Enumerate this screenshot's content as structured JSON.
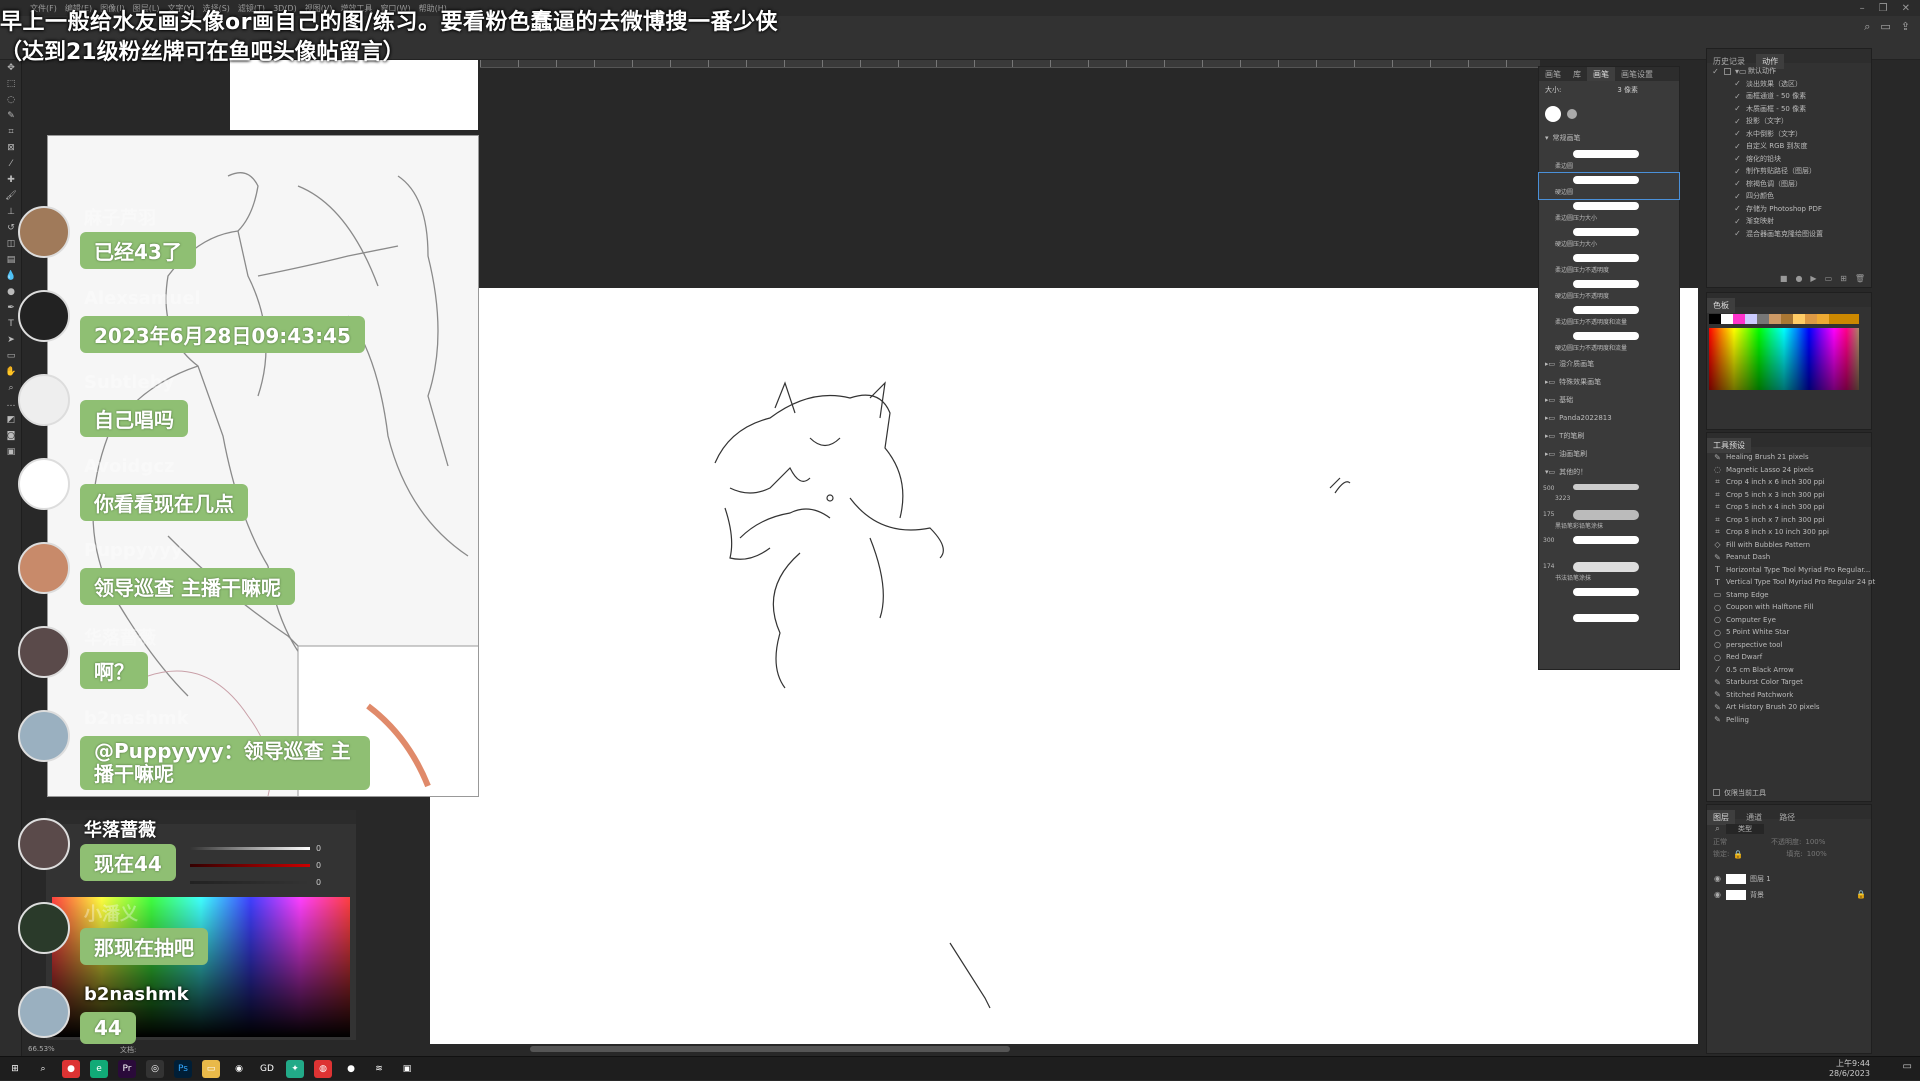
{
  "banner": {
    "line1": "早上一般给水友画头像or画自己的图/练习。要看粉色蠢逼的去微博搜一番少侠",
    "line2": "（达到21级粉丝牌可在鱼吧头像帖留言）"
  },
  "chat": [
    {
      "user": "麻子芦羽",
      "text": "已经43了"
    },
    {
      "user": "Alexsamuel",
      "text": "2023年6月28日09:43:45"
    },
    {
      "user": "Subtleby",
      "text": "自己唱吗"
    },
    {
      "user": "Avoidgcz",
      "text": "你看看现在几点"
    },
    {
      "user": "Puppyyyy",
      "text": "领导巡查 主播干嘛呢"
    },
    {
      "user": "华落蔷薇",
      "text": "啊？"
    },
    {
      "user": "b2nashmk",
      "text": "@Puppyyyy：领导巡查 主播干嘛呢"
    },
    {
      "user": "华落蔷薇",
      "text": "现在44"
    },
    {
      "user": "小潘义",
      "text": "那现在抽吧"
    },
    {
      "user": "b2nashmk",
      "text": "44"
    }
  ],
  "brush_panel": {
    "tabs": [
      "画笔",
      "库",
      "画笔",
      "画笔设置"
    ],
    "size_label": "大小:",
    "size_value": "3 像素",
    "group": "常规画笔",
    "brushes": [
      "柔边圆",
      "硬边圆",
      "柔边圆压力大小",
      "硬边圆压力大小",
      "柔边圆压力不透明度",
      "硬边圆压力不透明度",
      "柔边圆压力不透明度和流量",
      "硬边圆压力不透明度和流量"
    ],
    "folders": [
      "湿介质画笔",
      "特殊效果画笔",
      "基础",
      "Panda2022813",
      "T的笔刷",
      "油画笔刷",
      "其他的！"
    ],
    "custom_brushes": [
      "3223",
      "黑铅笔彩铅笔涂抹",
      "",
      "书法铅笔涂抹"
    ],
    "brush_numbers": [
      "500",
      "175",
      "300",
      "174"
    ]
  },
  "history_panel": {
    "tabs": [
      "历史记录",
      "动作"
    ],
    "set": "默认动作",
    "items": [
      "淡出效果（选区）",
      "画框通道 - 50 像素",
      "木质画框 - 50 像素",
      "投影（文字）",
      "水中倒影（文字）",
      "自定义 RGB 到灰度",
      "熔化的铅块",
      "制作剪贴路径（图层）",
      "棕褐色调（图层）",
      "四分颜色",
      "存储为 Photoshop PDF",
      "渐变映射",
      "混合器画笔克隆绘图设置"
    ]
  },
  "swatches_panel": {
    "title": "色板"
  },
  "tool_presets": {
    "title": "工具预设",
    "items": [
      "Healing Brush 21 pixels",
      "Magnetic Lasso 24 pixels",
      "Crop 4 inch x 6 inch 300 ppi",
      "Crop 5 inch x 3 inch 300 ppi",
      "Crop 5 inch x 4 inch 300 ppi",
      "Crop 5 inch x 7 inch 300 ppi",
      "Crop 8 inch x 10 inch 300 ppi",
      "Fill with Bubbles Pattern",
      "Peanut Dash",
      "Horizontal Type Tool Myriad Pro Regular...",
      "Vertical Type Tool Myriad Pro Regular 24 pt",
      "Stamp Edge",
      "Coupon with Halftone Fill",
      "Computer Eye",
      "5 Point White Star",
      "perspective tool",
      "Red Dwarf",
      "0.5 cm Black Arrow",
      "Starburst Color Target",
      "Stitched Patchwork",
      "Art History Brush 20 pixels",
      "Pelling"
    ],
    "footer": "仅限当前工具"
  },
  "layers_panel": {
    "tabs": [
      "图层",
      "通道",
      "路径"
    ],
    "search": "类型",
    "mode": "正常",
    "opacity_label": "不透明度:",
    "opacity": "100%",
    "lock_label": "锁定:",
    "fill_label": "填充:",
    "fill": "100%",
    "layers": [
      "图层 1",
      "背景"
    ]
  },
  "color_panel": {
    "values": [
      "0",
      "0",
      "0"
    ]
  },
  "status": {
    "zoom": "66.53%",
    "doc": "文档:"
  },
  "taskbar": {
    "time": "上午9:44",
    "date": "28/6/2023"
  },
  "menu": [
    "文件(F)",
    "编辑(E)",
    "图像(I)",
    "图层(L)",
    "文字(Y)",
    "选择(S)",
    "滤镜(T)",
    "3D(D)",
    "视图(V)",
    "增效工具",
    "窗口(W)",
    "帮助(H)"
  ]
}
